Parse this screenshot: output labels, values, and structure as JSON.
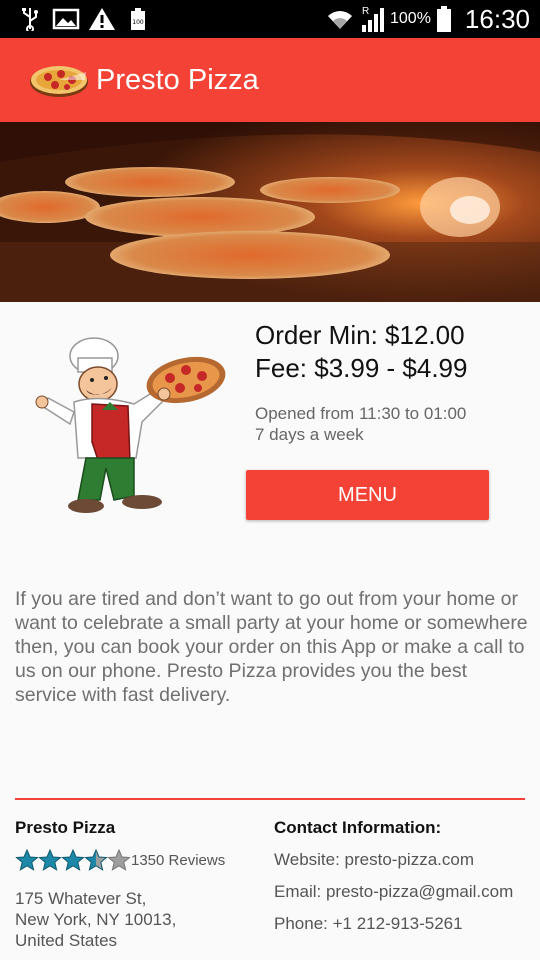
{
  "status_bar": {
    "battery_percent": "100%",
    "clock": "16:30",
    "icons": [
      "usb-icon",
      "image-icon",
      "warning-icon",
      "battery-small-icon",
      "wifi-icon",
      "signal-icon",
      "battery-icon"
    ]
  },
  "app_bar": {
    "title": "Presto Pizza",
    "logo_icon": "pizza-logo-icon",
    "background_color": "#f44336"
  },
  "restaurant": {
    "order_min": "Order Min: $12.00",
    "fee": "Fee: $3.99 - $4.99",
    "hours_line1": "Opened from 11:30 to 01:00",
    "hours_line2": "7 days a week",
    "menu_button": "MENU"
  },
  "description": "If you are tired and don’t want to go out from your home or want to celebrate a small party at your home or somewhere then, you can book your order on this App or make a call to us on our phone. Presto Pizza provides you the best service with fast delivery.",
  "footer": {
    "business_name": "Presto Pizza",
    "rating": 3.5,
    "rating_max": 5,
    "reviews": "1350 Reviews",
    "address_line1": "175 Whatever St,",
    "address_line2": "New York, NY 10013,",
    "address_line3": "United States",
    "contact_title": "Contact Information:",
    "website": "Website: presto-pizza.com",
    "email": "Email: presto-pizza@gmail.com",
    "phone": "Phone: +1 212-913-5261"
  },
  "colors": {
    "accent": "#f44336",
    "star": "#1e88a8",
    "star_empty": "#9e9e9e"
  }
}
